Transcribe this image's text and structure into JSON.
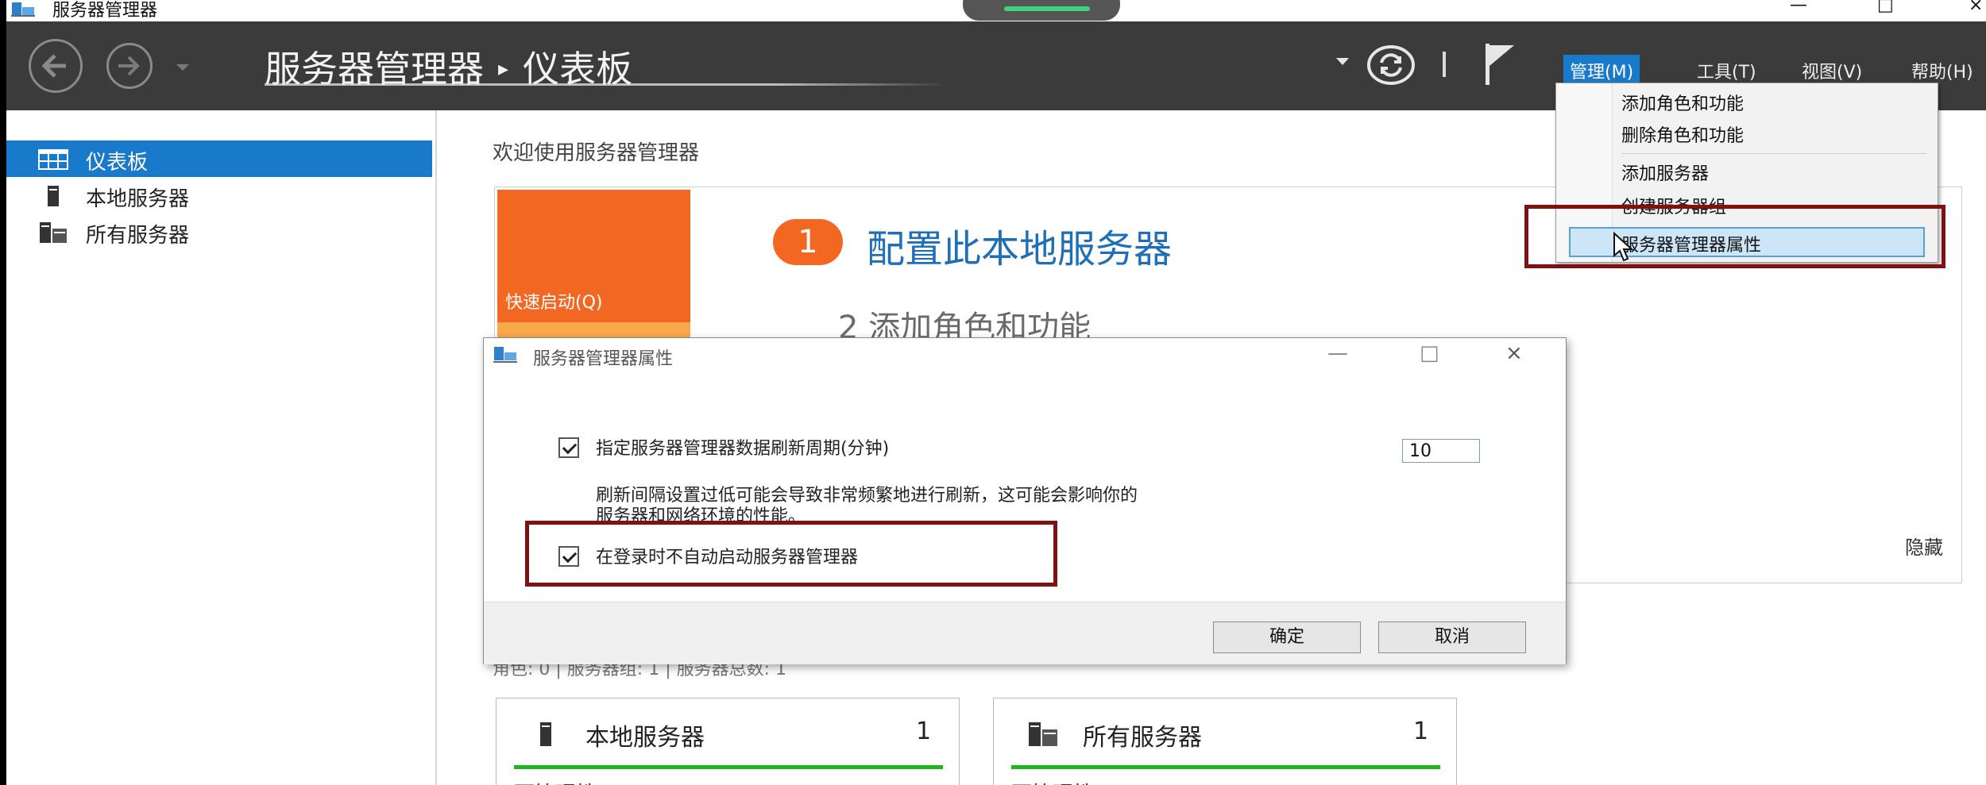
{
  "window": {
    "title": "服务器管理器",
    "controls": {
      "minimize": "—",
      "maximize": "□",
      "close": "×"
    }
  },
  "header": {
    "breadcrumb_root": "服务器管理器",
    "breadcrumb_sep": "▸",
    "breadcrumb_current": "仪表板",
    "menu": {
      "manage": "管理(M)",
      "tools": "工具(T)",
      "view": "视图(V)",
      "help": "帮助(H)"
    }
  },
  "manage_menu": {
    "items": [
      "添加角色和功能",
      "删除角色和功能",
      "添加服务器",
      "创建服务器组",
      "服务器管理器属性"
    ],
    "highlighted": "服务器管理器属性"
  },
  "sidebar": {
    "items": [
      {
        "label": "仪表板",
        "icon": "dashboard-icon",
        "active": true
      },
      {
        "label": "本地服务器",
        "icon": "local-server-icon",
        "active": false
      },
      {
        "label": "所有服务器",
        "icon": "all-servers-icon",
        "active": false
      }
    ]
  },
  "main": {
    "welcome": "欢迎使用服务器管理器",
    "quick_start_label": "快速启动(Q)",
    "step1_number": "1",
    "step1_text": "配置此本地服务器",
    "step2_text": "2  添加角色和功能",
    "hide_link": "隐藏",
    "counts_text": "角色: 0 | 服务器组: 1 | 服务器总数: 1",
    "tiles": [
      {
        "title": "本地服务器",
        "count": "1",
        "status": "可管理性"
      },
      {
        "title": "所有服务器",
        "count": "1",
        "status": "可管理性"
      }
    ]
  },
  "dialog": {
    "title": "服务器管理器属性",
    "refresh_label": "指定服务器管理器数据刷新周期(分钟)",
    "refresh_checked": true,
    "refresh_value": "10",
    "note_line1": "刷新间隔设置过低可能会导致非常频繁地进行刷新，这可能会影响你的",
    "note_line2": "服务器和网络环境的性能。",
    "autostart_label": "在登录时不自动启动服务器管理器",
    "autostart_checked": true,
    "ok": "确定",
    "cancel": "取消"
  },
  "colors": {
    "accent": "#1979ca",
    "orange": "#f26722",
    "header_bg": "#3b3b3b",
    "annotation_red": "#7e1111",
    "status_green": "#1fb51f"
  }
}
